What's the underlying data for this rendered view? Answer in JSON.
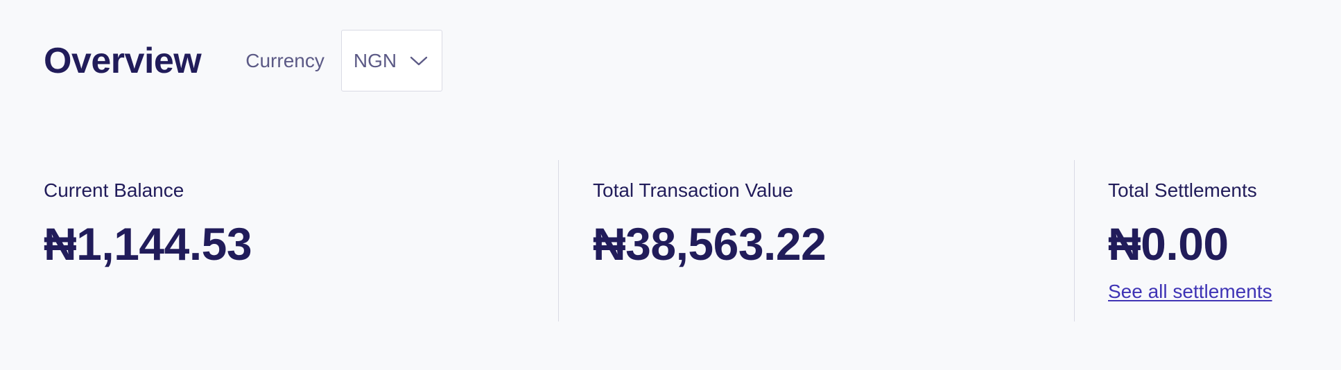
{
  "header": {
    "title": "Overview",
    "currency_label": "Currency",
    "currency_selected": "NGN",
    "chevron_icon": "chevron-down-icon"
  },
  "stats": [
    {
      "label": "Current Balance",
      "value": "₦1,144.53"
    },
    {
      "label": "Total Transaction Value",
      "value": "₦38,563.22"
    },
    {
      "label": "Total Settlements",
      "value": "₦0.00",
      "link": "See all settlements"
    }
  ],
  "colors": {
    "background": "#f8f9fb",
    "text_primary": "#211c5a",
    "text_muted": "#5c5a86",
    "link": "#3f34b5",
    "divider": "#d9dae4"
  }
}
